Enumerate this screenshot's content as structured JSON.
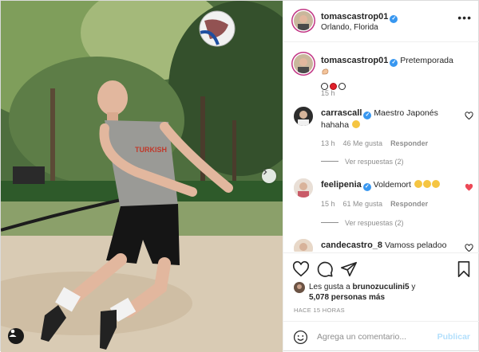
{
  "post": {
    "author": "tomascastrop01",
    "location": "Orlando, Florida",
    "caption": {
      "username": "tomascastrop01",
      "text": "Pretemporada",
      "time": "15 h"
    },
    "comments": [
      {
        "username": "carrascall",
        "text": "Maestro Japonés hahaha",
        "time": "13 h",
        "likes": "46 Me gusta",
        "reply_label": "Responder",
        "view_replies": "Ver respuestas (2)",
        "liked": false
      },
      {
        "username": "feelipenia",
        "text": "Voldemort",
        "time": "15 h",
        "likes": "61 Me gusta",
        "reply_label": "Responder",
        "view_replies": "Ver respuestas (2)",
        "liked": true
      },
      {
        "username": "candecastro_8",
        "text": "Vamoss peladoo",
        "liked": false
      }
    ],
    "liked_by_prefix": "Les gusta a ",
    "liked_by_user": "brunozuculini5",
    "liked_by_connector": " y",
    "liked_by_count": "5,078 personas más",
    "time_ago": "HACE 15 HORAS",
    "comment_placeholder": "Agrega un comentario...",
    "publish_label": "Publicar"
  },
  "icons": {
    "more": "more-icon",
    "like": "heart-icon",
    "comment": "comment-icon",
    "share": "share-icon",
    "save": "bookmark-icon",
    "emoji": "smile-icon",
    "next": "chevron-right-icon",
    "tag": "user-tag-icon"
  },
  "colors": {
    "verified": "#3897f0",
    "liked_heart": "#ed4956",
    "publish_disabled": "#b2dffc",
    "muted_text": "#8e8e8e"
  }
}
